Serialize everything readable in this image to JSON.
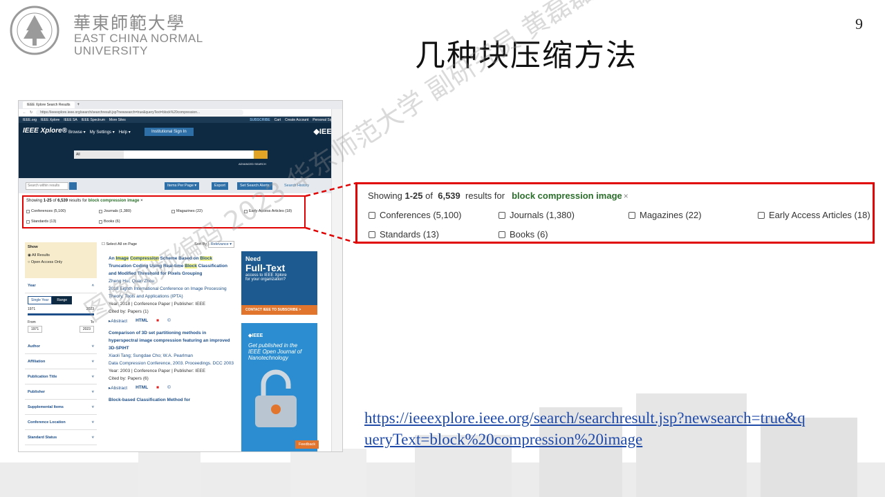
{
  "slide": {
    "page_number": "9",
    "title": "几种块压缩方法",
    "watermark": "图像视频编码 2023 华东师范大学 副研究员 黄磊磊"
  },
  "logo": {
    "cn": "華東師範大學",
    "en_line1": "EAST CHINA NORMAL",
    "en_line2": "UNIVERSITY"
  },
  "browser": {
    "tab_title": "IEEE Xplore Search Results",
    "url": "https://ieeexplore.ieee.org/search/searchresult.jsp?newsearch=true&queryText=block%20compression...",
    "topnav": [
      "IEEE.org",
      "IEEE Xplore",
      "IEEE SA",
      "IEEE Spectrum",
      "More Sites"
    ],
    "topnav_right": [
      "SUBSCRIBE",
      "Cart",
      "Create Account",
      "Personal Sign In"
    ],
    "brand": "IEEE Xplore®",
    "menu": [
      "Browse ▾",
      "My Settings ▾",
      "Help ▾"
    ],
    "signin": "Institutional Sign In",
    "ieee_logo": "◆IEEE",
    "search_scope": "All",
    "advanced": "ADVANCED SEARCH",
    "search_within": "Search within results",
    "items_per_page": "Items Per Page ▾",
    "export": "Export",
    "alerts": "Set Search Alerts",
    "history": "Search History",
    "select_all": "Select All on Page",
    "sort_by": "Sort By",
    "relevance": "Relevance ▾",
    "sidebar": {
      "show": "Show",
      "all_results": "All Results",
      "open_access": "Open Access Only",
      "year": "Year",
      "single_year": "Single Year",
      "range": "Range",
      "year_from": "1971",
      "year_to": "2023",
      "from_label": "From",
      "to_label": "To",
      "facets": [
        "Author",
        "Affiliation",
        "Publication Title",
        "Publisher",
        "Supplemental Items",
        "Conference Location",
        "Standard Status"
      ]
    },
    "results": [
      {
        "title_parts": [
          "An ",
          "Image",
          " ",
          "Compression",
          " Scheme Based on ",
          "Block",
          " Truncation Coding Using Real-time ",
          "Block",
          " Classification and Modified Threshold for Pixels Grouping"
        ],
        "authors": "Zheng Hui; Quan Zhou",
        "venue": "2018 Eighth International Conference on Image Processing Theory, Tools and Applications (IPTA)",
        "meta": "Year: 2018 | Conference Paper | Publisher: IEEE",
        "cited": "Cited by: Papers (1)"
      },
      {
        "title": "Comparison of 3D set partitioning methods in hyperspectral image compression featuring an improved 3D-SPIHT",
        "authors": "Xiaoli Tang; Sungdae Cho; W.A. Pearlman",
        "venue": "Data Compression Conference, 2003. Proceedings. DCC 2003",
        "meta": "Year: 2003 | Conference Paper | Publisher: IEEE",
        "cited": "Cited by: Papers (6)"
      },
      {
        "title": "Block-based Classification Method for"
      }
    ],
    "links": [
      "Abstract",
      "HTML"
    ],
    "ad1": {
      "line1": "Need",
      "line2": "Full-Text",
      "line3": "access to IEEE Xplore",
      "line4": "for your organization?",
      "cta": "CONTACT IEEE TO SUBSCRIBE >"
    },
    "ad2": {
      "brand": "◆IEEE",
      "text": "Get published in the IEEE Open Journal of Nanotechnology"
    },
    "feedback": "Feedback"
  },
  "results_summary": {
    "showing": "Showing",
    "range": "1-25",
    "of": "of",
    "total": "6,539",
    "results_for": "results for",
    "query": "block compression image",
    "clear": "×",
    "filters": [
      {
        "label": "Conferences (5,100)",
        "checked": false
      },
      {
        "label": "Journals (1,380)",
        "checked": false
      },
      {
        "label": "Magazines (22)",
        "checked": false
      },
      {
        "label": "Early Access Articles (18)",
        "checked": false
      },
      {
        "label": "Standards (13)",
        "checked": false
      },
      {
        "label": "Books (6)",
        "checked": false
      }
    ]
  },
  "link": {
    "url": "https://ieeexplore.ieee.org/search/searchresult.jsp?newsearch=true&queryText=block%20compression%20image"
  },
  "colors": {
    "highlight_red": "#e00000",
    "query_green": "#2b6e2b",
    "ieee_navy": "#0e2a43",
    "link_blue": "#1f4aa8"
  }
}
